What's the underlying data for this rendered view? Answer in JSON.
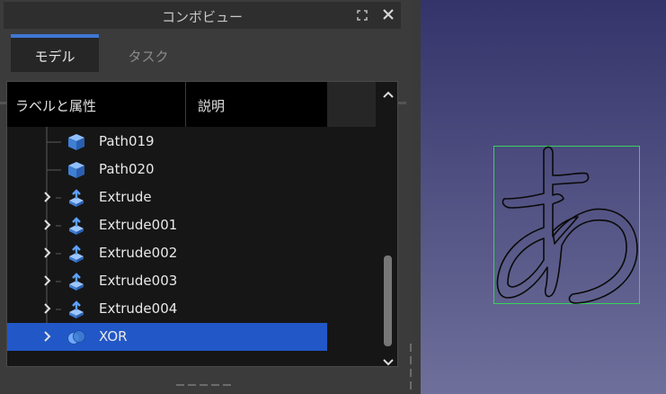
{
  "panel": {
    "title": "コンボビュー",
    "float_icon": "float-icon",
    "close_icon": "close-icon"
  },
  "tabs": [
    {
      "label": "モデル",
      "active": true
    },
    {
      "label": "タスク",
      "active": false
    }
  ],
  "tree": {
    "headers": {
      "label": "ラベルと属性",
      "description": "説明"
    },
    "rows": [
      {
        "label": "Path019",
        "icon": "cube-icon",
        "expandable": false,
        "selected": false
      },
      {
        "label": "Path020",
        "icon": "cube-icon",
        "expandable": false,
        "selected": false
      },
      {
        "label": "Extrude",
        "icon": "extrude-icon",
        "expandable": true,
        "selected": false
      },
      {
        "label": "Extrude001",
        "icon": "extrude-icon",
        "expandable": true,
        "selected": false
      },
      {
        "label": "Extrude002",
        "icon": "extrude-icon",
        "expandable": true,
        "selected": false
      },
      {
        "label": "Extrude003",
        "icon": "extrude-icon",
        "expandable": true,
        "selected": false
      },
      {
        "label": "Extrude004",
        "icon": "extrude-icon",
        "expandable": true,
        "selected": false
      },
      {
        "label": "XOR",
        "icon": "boolean-xor-icon",
        "expandable": true,
        "selected": true
      }
    ]
  },
  "colors": {
    "selection": "#2257c7",
    "active_tab_accent": "#3f77d4",
    "bbox": "#35d35a",
    "viewport_top": "#34346b",
    "viewport_bottom": "#6f6f9b"
  }
}
